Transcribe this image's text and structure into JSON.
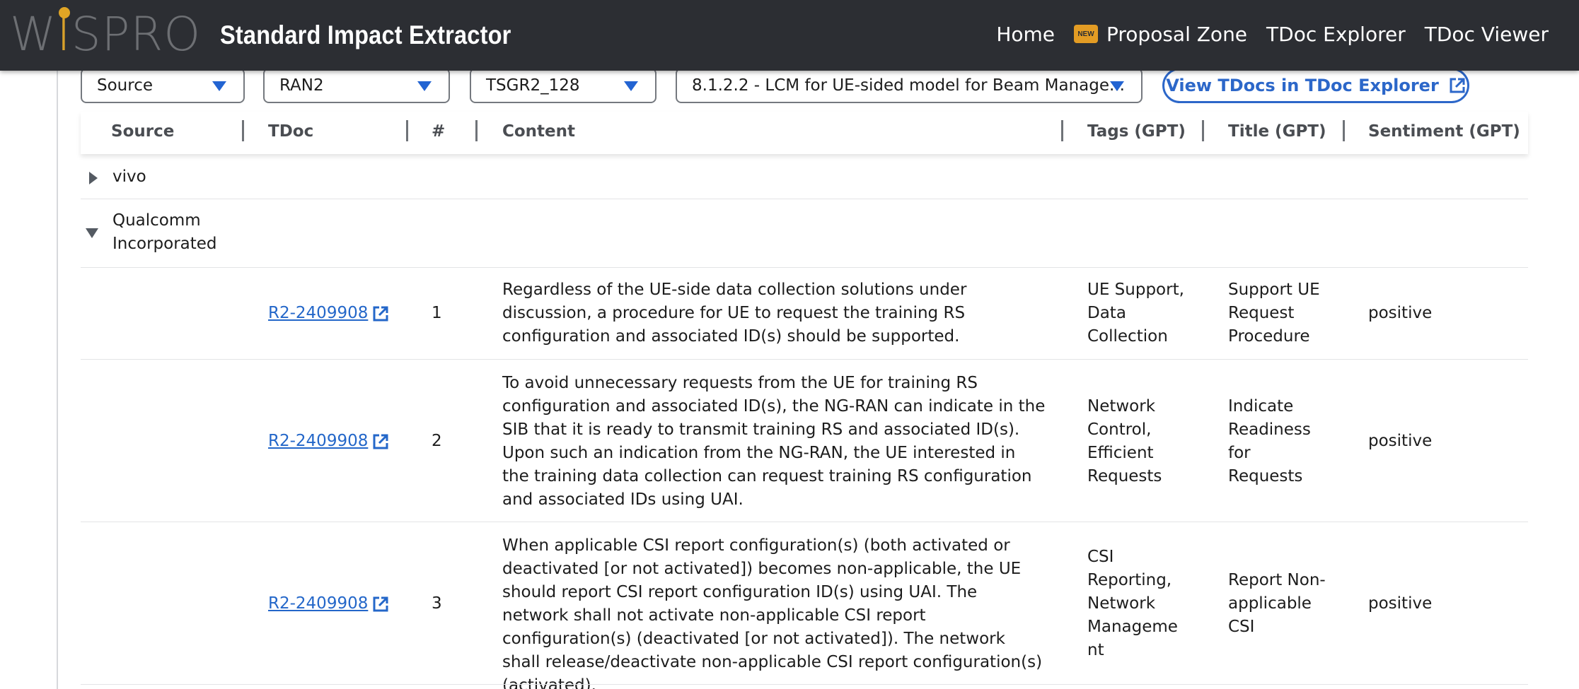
{
  "brand": {
    "logo_text": "WISPRO",
    "app_title": "Standard Impact Extractor"
  },
  "nav": {
    "items": [
      {
        "label": "Home"
      },
      {
        "label": "Proposal Zone",
        "badge": "NEW"
      },
      {
        "label": "TDoc Explorer"
      },
      {
        "label": "TDoc Viewer"
      }
    ]
  },
  "filters": {
    "source": "Source",
    "group": "RAN2",
    "meeting": "TSGR2_128",
    "agenda": "8.1.2.2 - LCM for UE-sided model for Beam Manage...",
    "view_button": "View TDocs in TDoc Explorer"
  },
  "table": {
    "headers": {
      "source": "Source",
      "tdoc": "TDoc",
      "num": "#",
      "content": "Content",
      "tags": "Tags (GPT)",
      "title": "Title (GPT)",
      "sentiment": "Sentiment (GPT)"
    },
    "groups": [
      {
        "name": "vivo",
        "expanded": false
      },
      {
        "name": "Qualcomm Incorporated",
        "expanded": true
      }
    ],
    "rows": [
      {
        "tdoc": "R2-2409908",
        "num": "1",
        "content": "Regardless of the UE-side data collection solutions under discussion, a procedure for UE to request the training RS configuration and associated ID(s) should be supported.",
        "tags": "UE Support, Data Collection",
        "title": "Support UE Request Procedure",
        "sentiment": "positive"
      },
      {
        "tdoc": "R2-2409908",
        "num": "2",
        "content": "To avoid unnecessary requests from the UE for training RS configuration and associated ID(s), the NG-RAN can indicate in the SIB that it is ready to transmit training RS and associated ID(s). Upon such an indication from the NG-RAN, the UE interested in the training data collection can request training RS configuration and associated IDs using UAI.",
        "tags": "Network Control, Efficient Requests",
        "title": "Indicate Readiness for Requests",
        "sentiment": "positive"
      },
      {
        "tdoc": "R2-2409908",
        "num": "3",
        "content": "When applicable CSI report configuration(s) (both activated or deactivated [or not activated]) becomes non-applicable, the UE should report CSI report configuration ID(s) using UAI. The network shall not activate non-applicable CSI report configuration(s) (deactivated [or not activated]). The network shall release/deactivate non-applicable CSI report configuration(s) (activated).",
        "tags": "CSI Reporting, Network Manageme nt",
        "title": "Report Non-applicable CSI",
        "sentiment": "positive"
      }
    ]
  },
  "colors": {
    "topbar": "#2c2e33",
    "accent": "#2467c9",
    "badge": "#e39c24",
    "logo_i": "#e0a525"
  },
  "icons": {
    "external_link": "external-link-icon",
    "caret": "caret-down-icon",
    "expand": "triangle-right-icon",
    "collapse": "triangle-down-icon"
  }
}
